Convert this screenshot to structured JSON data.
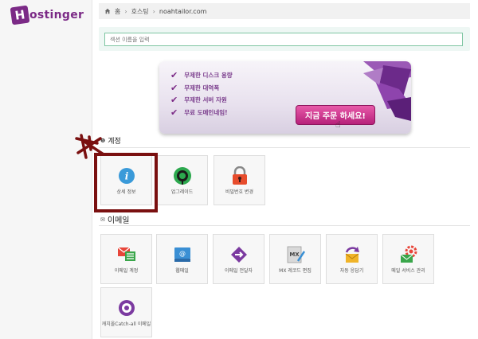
{
  "brand": {
    "logo_letter": "H",
    "logo_text": "ostinger"
  },
  "breadcrumb": {
    "home_icon": "home-icon",
    "home": "홈",
    "hosting": "호스팅",
    "domain": "noahtailor.com"
  },
  "search": {
    "placeholder": "섹션 이름을 입력"
  },
  "banner": {
    "features": [
      "무제한 디스크 용량",
      "무제한 대역폭",
      "무제한 서버 자원",
      "무료 도메인네임!"
    ],
    "order_button": "지금 주문 하세요!"
  },
  "account": {
    "title": "계정",
    "tiles": [
      {
        "label": "상세 정보",
        "icon": "info-icon"
      },
      {
        "label": "업그레이드",
        "icon": "upgrade-icon"
      },
      {
        "label": "비밀번호 변경",
        "icon": "lock-icon"
      }
    ]
  },
  "email": {
    "title": "이메일",
    "tiles": [
      {
        "label": "이메일 계정",
        "icon": "email-accounts-icon"
      },
      {
        "label": "웹메일",
        "icon": "webmail-icon"
      },
      {
        "label": "이메일 전달자",
        "icon": "forwarder-icon"
      },
      {
        "label": "MX 레코드 편집",
        "icon": "mx-record-icon"
      },
      {
        "label": "자동 응답기",
        "icon": "autoresponder-icon"
      },
      {
        "label": "메일 서비스 관리",
        "icon": "mail-settings-icon"
      },
      {
        "label": "캐치올Catch-all 이메일",
        "icon": "catch-all-icon"
      }
    ]
  },
  "colors": {
    "brand": "#7b2a86",
    "annotation": "#7a1010"
  }
}
